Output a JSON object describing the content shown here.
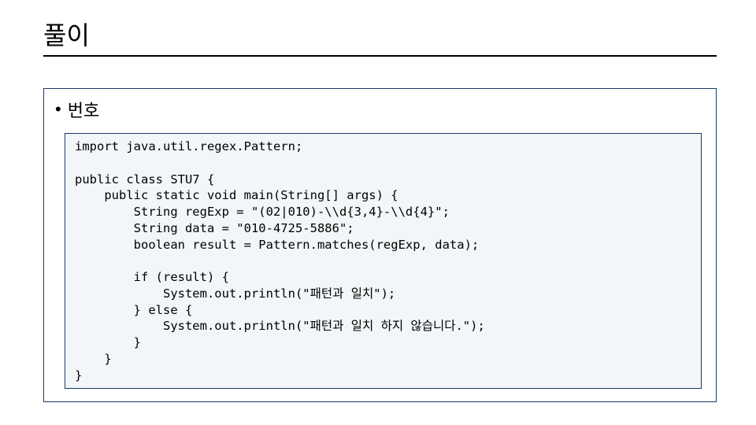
{
  "slide": {
    "title": "풀이",
    "bullet_label": "번호"
  },
  "code": {
    "line1": "import java.util.regex.Pattern;",
    "line2": "",
    "line3": "public class STU7 {",
    "line4": "    public static void main(String[] args) {",
    "line5": "        String regExp = \"(02|010)-\\\\d{3,4}-\\\\d{4}\";",
    "line6": "        String data = \"010-4725-5886\";",
    "line7": "        boolean result = Pattern.matches(regExp, data);",
    "line8": "",
    "line9": "        if (result) {",
    "line10": "            System.out.println(\"패턴과 일치\");",
    "line11": "        } else {",
    "line12": "            System.out.println(\"패턴과 일치 하지 않습니다.\");",
    "line13": "        }",
    "line14": "    }",
    "line15": "}"
  }
}
